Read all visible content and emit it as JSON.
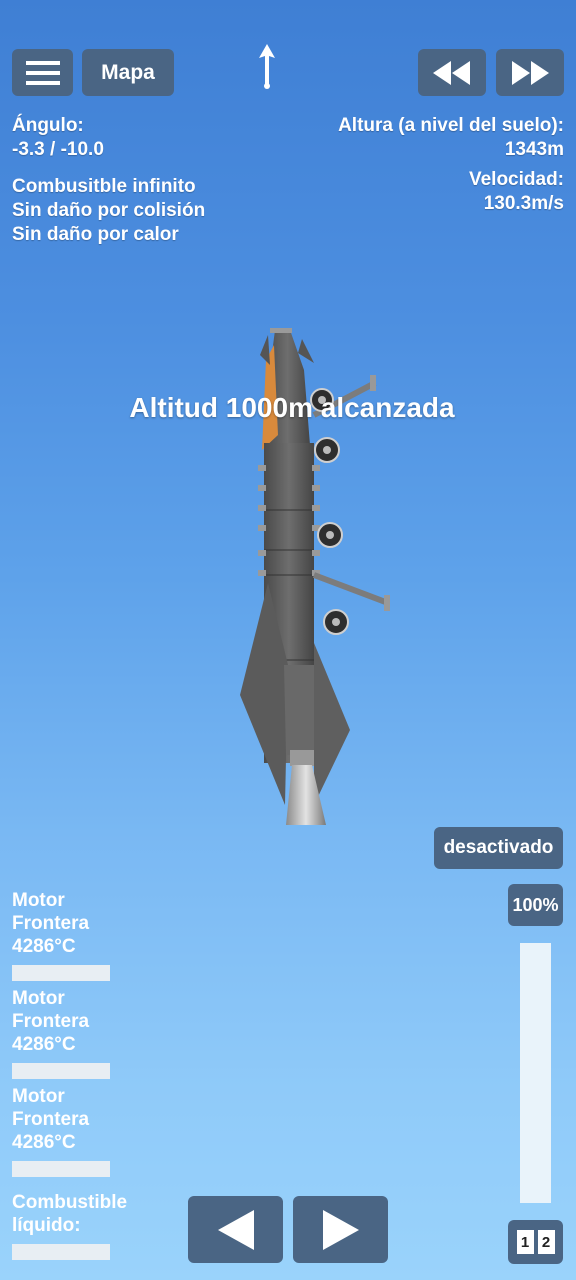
{
  "toolbar": {
    "menu_icon": "hamburger-icon",
    "map_label": "Mapa",
    "direction_icon": "arrow-up-icon",
    "rewind_icon": "rewind-icon",
    "fastforward_icon": "fast-forward-icon"
  },
  "telemetry": {
    "angle_label": "Ángulo:",
    "angle_value": "-3.3 / -10.0",
    "cheats": [
      "Combusitble infinito",
      "Sin daño por colisión",
      "Sin daño por calor"
    ],
    "altitude_label": "Altura (a nivel del suelo):",
    "altitude_value": "1343m",
    "velocity_label": "Velocidad:",
    "velocity_value": "130.3m/s"
  },
  "message": "Altitud 1000m alcanzada",
  "controls": {
    "toggle_label": "desactivado",
    "throttle_label": "100%",
    "throttle_level": 1.0,
    "stage_labels": [
      "1",
      "2"
    ]
  },
  "gauges": [
    {
      "line1": "Motor",
      "line2": "Frontera",
      "line3": "4286°C"
    },
    {
      "line1": "Motor",
      "line2": "Frontera",
      "line3": "4286°C"
    },
    {
      "line1": "Motor",
      "line2": "Frontera",
      "line3": "4286°C"
    }
  ],
  "fuel": {
    "line1": "Combustible",
    "line2": "líquido:"
  },
  "nav": {
    "left_icon": "turn-left-icon",
    "right_icon": "turn-right-icon"
  }
}
